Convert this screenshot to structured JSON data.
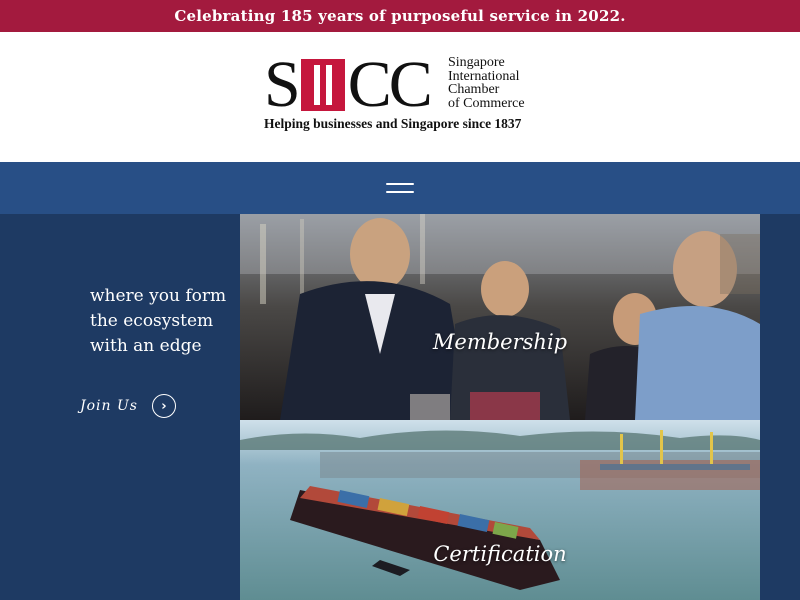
{
  "banner": {
    "text": "Celebrating 185 years of purposeful service in 2022."
  },
  "logo": {
    "mark_left": "S",
    "mark_right": "CC",
    "name_lines": [
      "Singapore",
      "International",
      "Chamber",
      "of Commerce"
    ],
    "tagline": "Helping businesses and Singapore since 1837",
    "colors": {
      "accent": "#c5163c",
      "text": "#111111"
    }
  },
  "nav": {
    "menu_icon": "hamburger-icon"
  },
  "hero": {
    "tagline": "where you form the ecosystem with an edge",
    "join_label": "Join Us",
    "join_icon": "chevron-right-icon"
  },
  "tiles": [
    {
      "label": "Membership"
    },
    {
      "label": "Certification"
    }
  ],
  "colors": {
    "banner": "#a31a3e",
    "nav": "#284f86",
    "panel": "#1e3a63"
  }
}
